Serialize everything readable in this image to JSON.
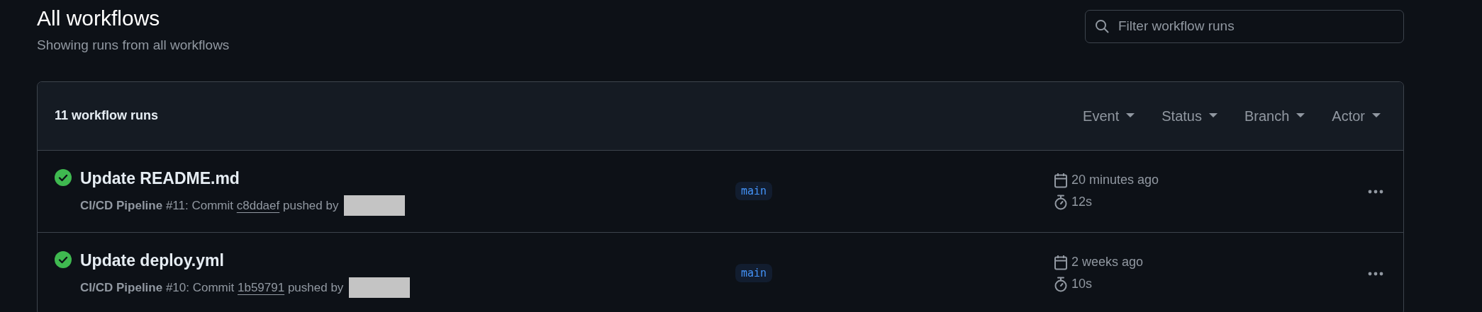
{
  "page": {
    "title": "All workflows",
    "subtitle": "Showing runs from all workflows"
  },
  "search": {
    "placeholder": "Filter workflow runs"
  },
  "runs_header": {
    "count": "11 workflow runs",
    "filters": [
      "Event",
      "Status",
      "Branch",
      "Actor"
    ]
  },
  "runs": [
    {
      "title": "Update README.md",
      "kind": "success",
      "workflow": "CI/CD Pipeline",
      "number": "#11",
      "commit_label": ": Commit",
      "commit": "c8ddaef",
      "pushed": "pushed by",
      "branch": "main",
      "when": "20 minutes ago",
      "duration": "12s"
    },
    {
      "title": "Update deploy.yml",
      "kind": "success",
      "workflow": "CI/CD Pipeline",
      "number": "#10",
      "commit_label": ": Commit",
      "commit": "1b59791",
      "pushed": "pushed by",
      "branch": "main",
      "when": "2 weeks ago",
      "duration": "10s"
    }
  ]
}
